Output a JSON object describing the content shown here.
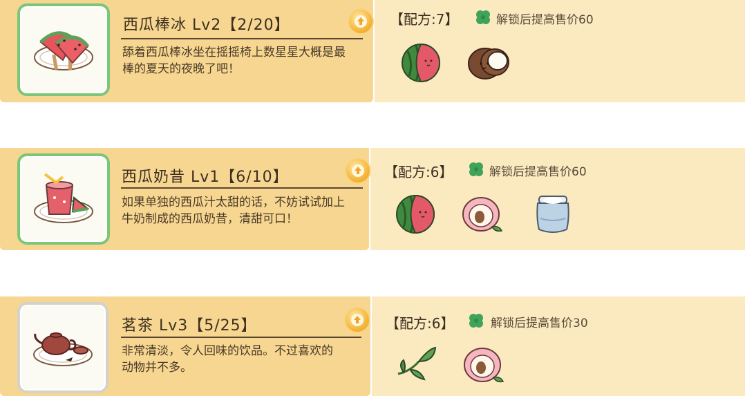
{
  "recipes": [
    {
      "title": "西瓜棒冰 Lv2【2/20】",
      "description": "舔着西瓜棒冰坐在摇摇椅上数星星大概是最棒的夏天的夜晚了吧！",
      "recipe_label": "【配方:7】",
      "unlock_text": "解锁后提高售价60",
      "thumb_icon": "watermelon-popsicle-icon",
      "ingredients": [
        "watermelon-icon",
        "coconut-icon"
      ]
    },
    {
      "title": "西瓜奶昔 Lv1【6/10】",
      "description": "如果单独的西瓜汁太甜的话，不妨试试加上牛奶制成的西瓜奶昔，清甜可口！",
      "recipe_label": "【配方:6】",
      "unlock_text": "解锁后提高售价60",
      "thumb_icon": "watermelon-milkshake-icon",
      "ingredients": [
        "watermelon-icon",
        "peach-icon",
        "milk-jar-icon"
      ]
    },
    {
      "title": "茗茶 Lv3【5/25】",
      "description": "非常清淡，令人回味的饮品。不过喜欢的动物并不多。",
      "recipe_label": "【配方:6】",
      "unlock_text": "解锁后提高售价30",
      "thumb_icon": "teapot-icon",
      "ingredients": [
        "tea-leaf-icon",
        "peach-icon"
      ]
    }
  ],
  "colors": {
    "panel_left": "#f6d690",
    "panel_right": "#fbe9c0",
    "thumb_border_active": "#7cc67a",
    "thumb_border_inactive": "#d6d2cb",
    "clover": "#3fa35a",
    "upgrade_button": "#f6b73c"
  }
}
